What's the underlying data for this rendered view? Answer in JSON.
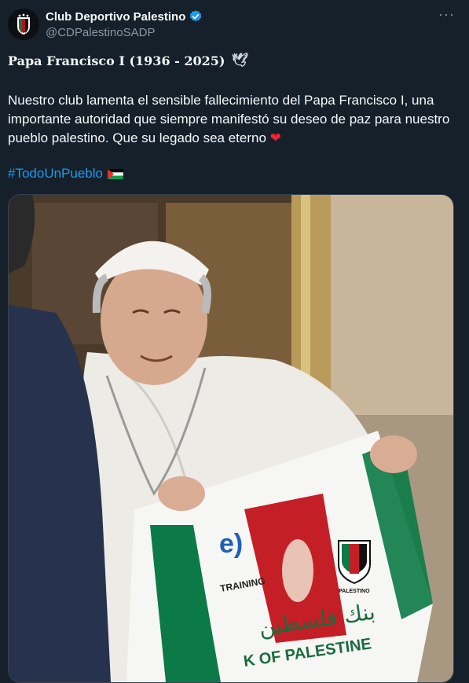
{
  "author": {
    "name": "Club Deportivo Palestino",
    "handle": "@CDPalestinoSADP",
    "verified_icon": "verified-badge-icon",
    "avatar_icon": "club-crest-icon"
  },
  "more_label": "···",
  "post": {
    "title": "Papa Francisco I (1936 - 2025)",
    "title_icon": "dove-icon",
    "body": "Nuestro club lamenta el sensible fallecimiento del Papa Francisco I, una importante autoridad que siempre manifestó su deseo de paz para nuestro pueblo palestino. Que su legado sea eterno",
    "heart_icon": "❤",
    "hashtag": "#TodoUnPueblo",
    "hashtag_icon": "palestine-flag-icon"
  },
  "media": {
    "alt_icon": "photo",
    "jersey_text_1": "e)",
    "jersey_text_2": "TRAINING",
    "jersey_text_3": "PALESTINO",
    "jersey_text_4": "بنك فلسطين",
    "jersey_text_5": "K OF PALESTINE"
  },
  "colors": {
    "background": "#15202b",
    "text": "#f7f9f9",
    "muted": "#8b98a5",
    "link": "#1d9bf0",
    "verified": "#1d9bf0"
  }
}
